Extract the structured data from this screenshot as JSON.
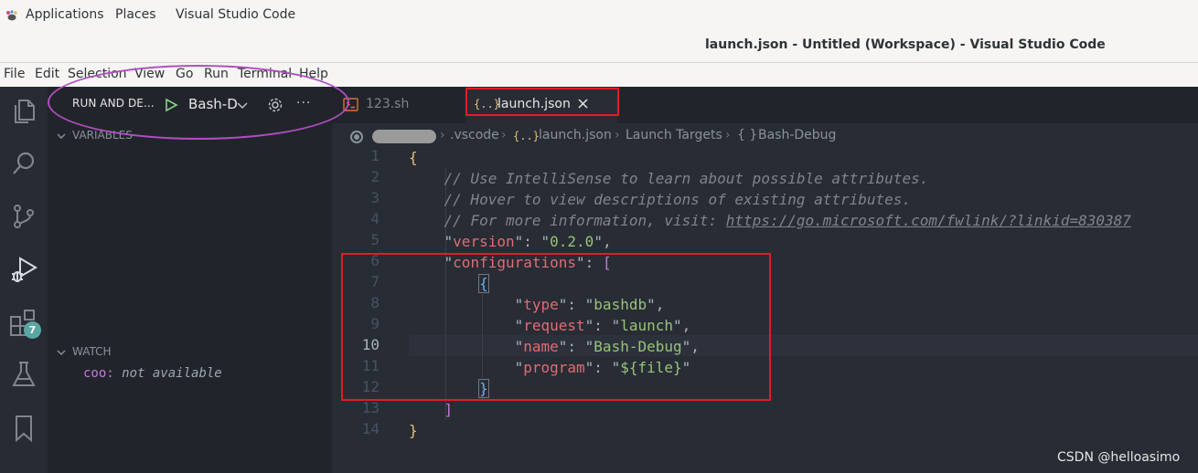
{
  "gnome": {
    "applications": "Applications",
    "places": "Places",
    "app_name": "Visual Studio Code"
  },
  "window": {
    "title": "launch.json - Untitled (Workspace) - Visual Studio Code"
  },
  "menubar": [
    "File",
    "Edit",
    "Selection",
    "View",
    "Go",
    "Run",
    "Terminal",
    "Help"
  ],
  "activitybar": {
    "items": [
      "explorer-icon",
      "search-icon",
      "source-control-icon",
      "run-debug-icon",
      "extensions-icon",
      "testing-icon",
      "bookmarks-icon"
    ],
    "extensions_badge": "7"
  },
  "sidebar": {
    "title": "RUN AND DE...",
    "config": "Bash-D",
    "variables_title": "VARIABLES",
    "watch_title": "WATCH",
    "watch_items": [
      {
        "name": "coo",
        "value": "not available"
      }
    ]
  },
  "tabs": [
    {
      "label": "123.sh",
      "icon": "terminal-file-icon",
      "active": false
    },
    {
      "label": "launch.json",
      "icon_text": "{..}",
      "active": true
    }
  ],
  "breadcrumb": {
    "folder": ".vscode",
    "file": "launch.json",
    "file_icon": "{..}",
    "node1": "Launch Targets",
    "node2_icon": "{ }",
    "node2": "Bash-Debug"
  },
  "code": {
    "line_numbers": [
      "1",
      "2",
      "3",
      "4",
      "5",
      "6",
      "7",
      "8",
      "9",
      "10",
      "11",
      "12",
      "13",
      "14"
    ],
    "active_line": "10",
    "comment1": "// Use IntelliSense to learn about possible attributes.",
    "comment2": "// Hover to view descriptions of existing attributes.",
    "comment3_prefix": "// For more information, visit: ",
    "comment3_url": "https://go.microsoft.com/fwlink/?linkid=830387",
    "version_key": "version",
    "version_value": "0.2.0",
    "configurations_key": "configurations",
    "type_key": "type",
    "type_value": "bashdb",
    "request_key": "request",
    "request_value": "launch",
    "name_key": "name",
    "name_value": "Bash-Debug",
    "program_key": "program",
    "program_value": "${file}"
  },
  "watermark": "CSDN @helloasimo",
  "colors": {
    "activity_bar": "#272b33",
    "sidebar": "#21252b",
    "editor": "#282c34",
    "annotation_red": "#e01e24",
    "annotation_purple": "#b04ec0"
  }
}
